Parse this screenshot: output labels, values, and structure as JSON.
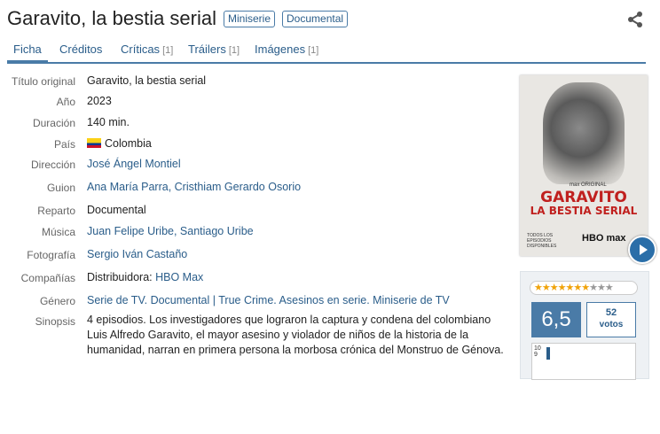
{
  "header": {
    "title": "Garavito, la bestia serial",
    "tags": [
      "Miniserie",
      "Documental"
    ],
    "share_icon": "share-icon"
  },
  "tabs": [
    {
      "label": "Ficha",
      "count": ""
    },
    {
      "label": "Créditos",
      "count": ""
    },
    {
      "label": "Críticas",
      "count": "[1]"
    },
    {
      "label": "Tráilers",
      "count": "[1]"
    },
    {
      "label": "Imágenes",
      "count": "[1]"
    }
  ],
  "info": {
    "titulo_original": {
      "label": "Título original",
      "value": "Garavito, la bestia serial"
    },
    "anio": {
      "label": "Año",
      "value": "2023"
    },
    "duracion": {
      "label": "Duración",
      "value": "140 min."
    },
    "pais": {
      "label": "País",
      "value": "Colombia"
    },
    "direccion": {
      "label": "Dirección",
      "value": "José Ángel Montiel"
    },
    "guion": {
      "label": "Guion",
      "value": "Ana María Parra, Cristhiam Gerardo Osorio"
    },
    "reparto": {
      "label": "Reparto",
      "value": "Documental"
    },
    "musica": {
      "label": "Música",
      "value": "Juan Felipe Uribe, Santiago Uribe"
    },
    "fotografia": {
      "label": "Fotografía",
      "value": "Sergio Iván Castaño"
    },
    "companias": {
      "label": "Compañías",
      "prefix": "Distribuidora:",
      "value": "HBO Max"
    },
    "genero": {
      "label": "Género",
      "value": "Serie de TV. Documental | True Crime. Asesinos en serie. Miniserie de TV"
    },
    "sinopsis": {
      "label": "Sinopsis",
      "value": "4 episodios. Los investigadores que lograron la captura y condena del colombiano Luis Alfredo Garavito, el mayor asesino y violador de niños de la historia de la humanidad, narran en primera persona la morbosa crónica del Monstruo de Génova."
    }
  },
  "poster": {
    "title_line1": "GARAVITO",
    "title_line2": "LA BESTIA SERIAL",
    "small_text": "TODOS LOS EPISODIOS DISPONIBLES",
    "logo": "HBO max",
    "max_tag": "max ORIGINAL"
  },
  "rating": {
    "stars_filled": 6.5,
    "stars_total": 10,
    "average": "6,5",
    "votes_count": "52",
    "votes_label": "votos",
    "histogram_axis": "10\n9"
  },
  "colors": {
    "accent": "#4a7ba7",
    "link": "#2a5d8a",
    "star": "#f0a30a",
    "poster_title": "#c0201e"
  }
}
